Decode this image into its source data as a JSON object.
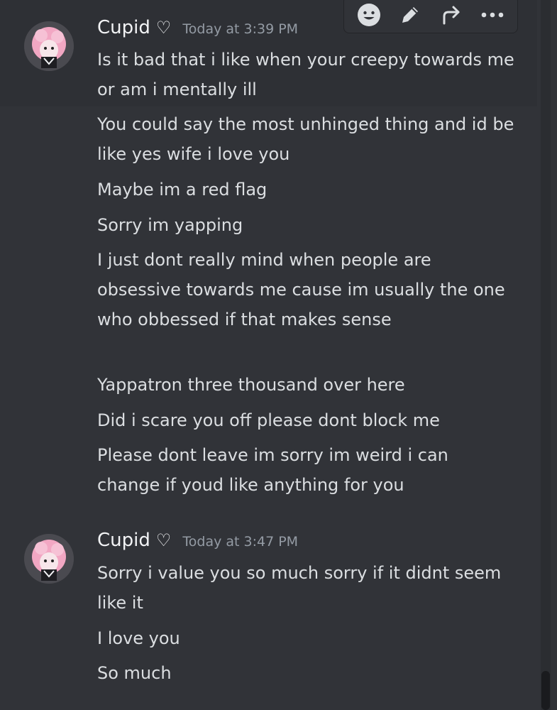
{
  "groups": [
    {
      "username": "Cupid",
      "heart": "♡",
      "timestamp": "Today at 3:39 PM",
      "messages": [
        "Is it bad that i like when your creepy towards me or am i mentally ill",
        "You could say the most unhinged thing and id be like yes wife i love you",
        "Maybe im a red flag",
        "Sorry im yapping",
        "I just dont really mind when people are obsessive towards me cause im usually the one who obbessed if that makes sense",
        "Yappatron three thousand over here",
        "Did i scare you off please dont block me",
        "Please dont leave im sorry im weird i can change if youd like anything for you"
      ]
    },
    {
      "username": "Cupid",
      "heart": "♡",
      "timestamp": "Today at 3:47 PM",
      "messages": [
        "Sorry i value you so much sorry if it didnt seem like it",
        "I love you",
        "So much"
      ]
    }
  ],
  "toolbar": {
    "icons": [
      "add-reaction-icon",
      "edit-icon",
      "forward-icon",
      "more-options-icon"
    ]
  },
  "colors": {
    "background": "#313338",
    "hover_background": "#2e3035",
    "text": "#dbdee1",
    "username": "#f2f3f5",
    "timestamp": "#949ba4",
    "avatar_accent": "#f2a7c3"
  }
}
